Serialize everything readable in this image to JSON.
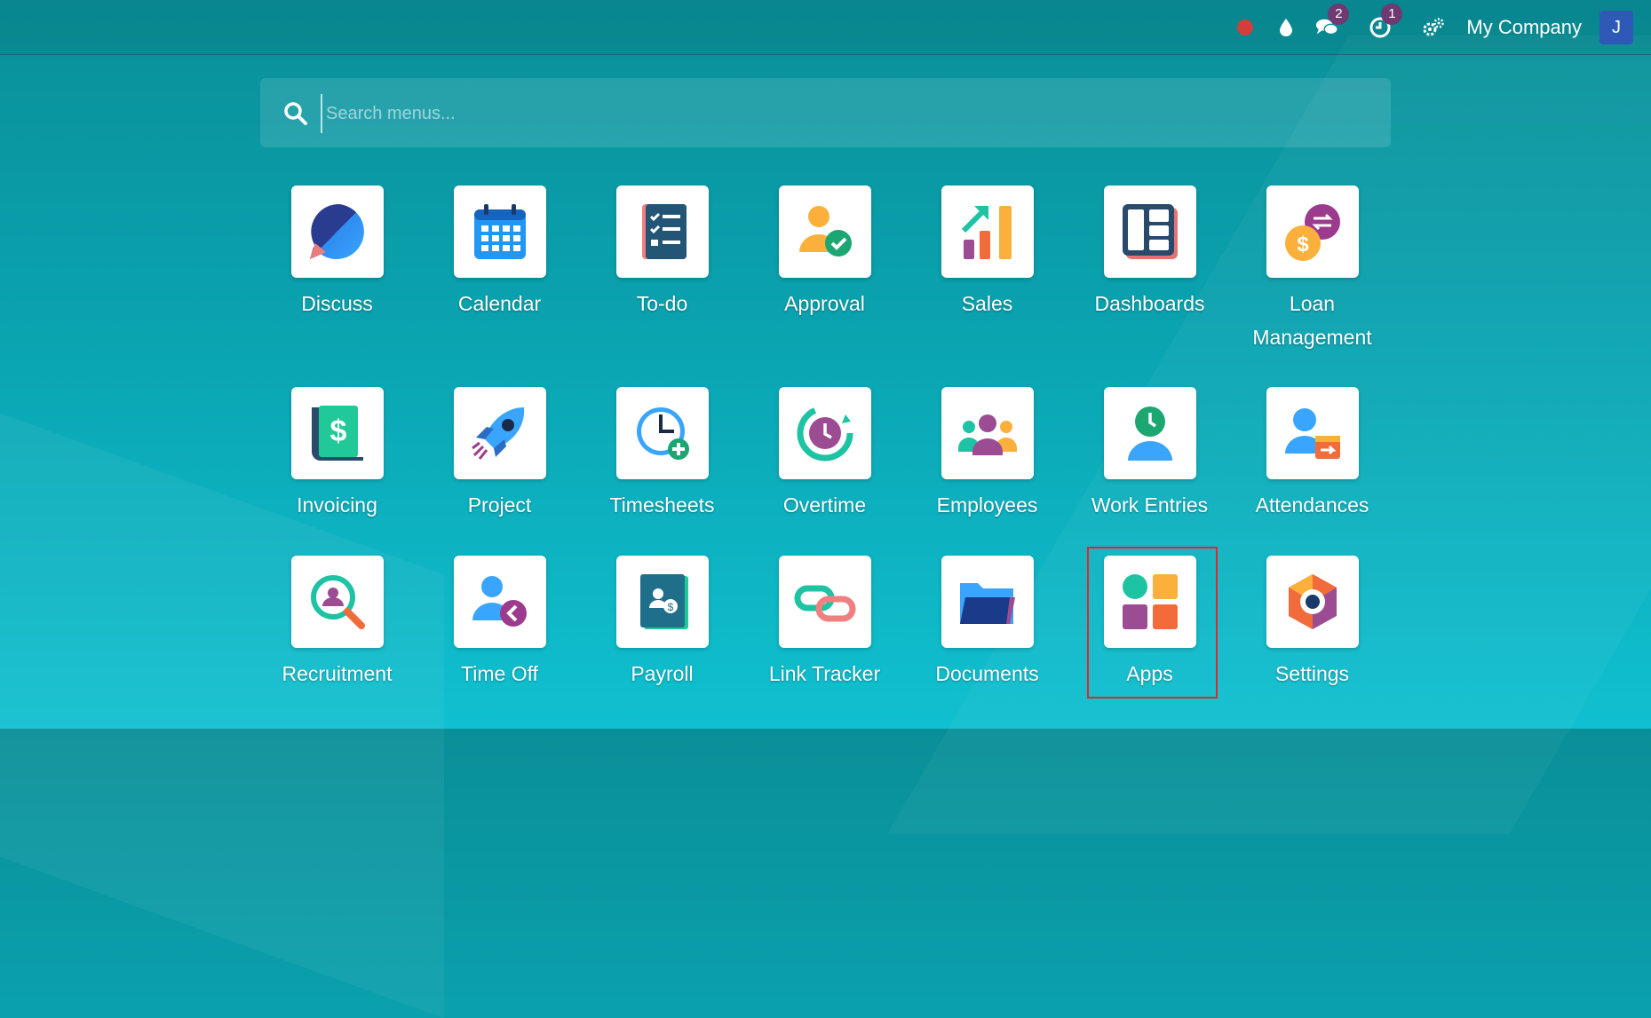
{
  "navbar": {
    "company": "My Company",
    "avatar_initial": "J",
    "messages_count": "2",
    "activities_count": "1",
    "icons": [
      "record-icon",
      "droplet-icon",
      "chat-icon",
      "clock-activity-icon",
      "gears-icon"
    ]
  },
  "search": {
    "placeholder": "Search menus...",
    "value": ""
  },
  "apps": [
    {
      "label": "Discuss",
      "icon": "discuss-icon"
    },
    {
      "label": "Calendar",
      "icon": "calendar-icon"
    },
    {
      "label": "To-do",
      "icon": "todo-icon"
    },
    {
      "label": "Approval",
      "icon": "approval-icon"
    },
    {
      "label": "Sales",
      "icon": "sales-icon"
    },
    {
      "label": "Dashboards",
      "icon": "dashboards-icon"
    },
    {
      "label": "Loan Management",
      "icon": "loan-management-icon"
    },
    {
      "label": "Invoicing",
      "icon": "invoicing-icon"
    },
    {
      "label": "Project",
      "icon": "project-icon"
    },
    {
      "label": "Timesheets",
      "icon": "timesheets-icon"
    },
    {
      "label": "Overtime",
      "icon": "overtime-icon"
    },
    {
      "label": "Employees",
      "icon": "employees-icon"
    },
    {
      "label": "Work Entries",
      "icon": "work-entries-icon"
    },
    {
      "label": "Attendances",
      "icon": "attendances-icon"
    },
    {
      "label": "Recruitment",
      "icon": "recruitment-icon"
    },
    {
      "label": "Time Off",
      "icon": "time-off-icon"
    },
    {
      "label": "Payroll",
      "icon": "payroll-icon"
    },
    {
      "label": "Link Tracker",
      "icon": "link-tracker-icon"
    },
    {
      "label": "Documents",
      "icon": "documents-icon"
    },
    {
      "label": "Apps",
      "icon": "apps-icon"
    },
    {
      "label": "Settings",
      "icon": "settings-icon"
    }
  ],
  "highlighted_app": "Apps",
  "colors": {
    "background_top": "#0a8f98",
    "background_bottom": "#10c0d0",
    "badge": "#6d3a72",
    "avatar": "#2e59b6",
    "record": "#d23f3a",
    "highlight_border": "#e0282b"
  }
}
